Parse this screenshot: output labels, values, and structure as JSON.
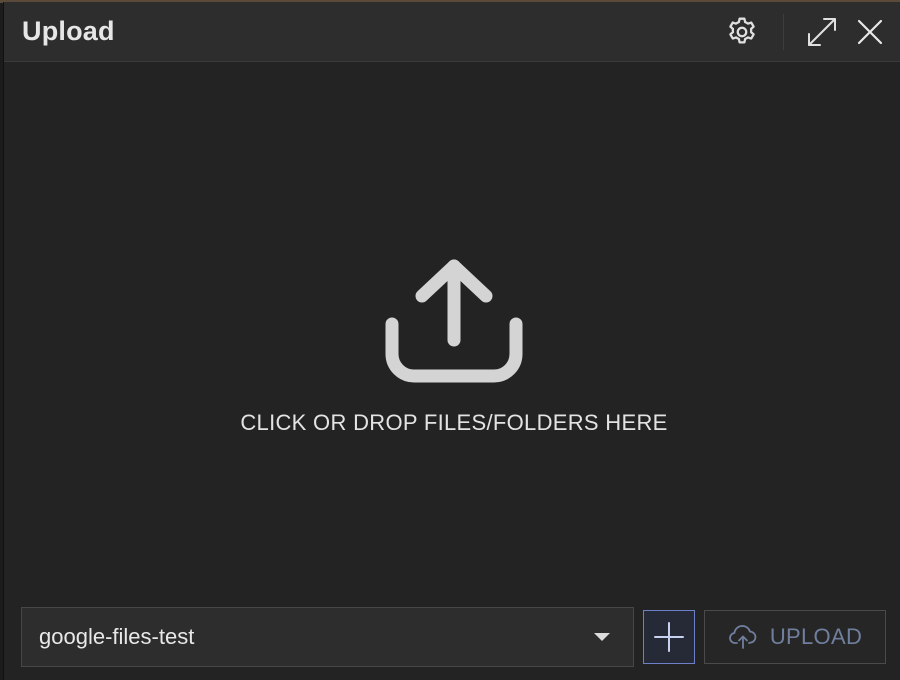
{
  "window": {
    "title": "Upload"
  },
  "toolbar": {
    "settings_icon": "gear-icon",
    "expand_icon": "expand-icon",
    "close_icon": "close-icon"
  },
  "dropzone": {
    "icon": "upload-tray-icon",
    "text": "CLICK OR DROP FILES/FOLDERS HERE"
  },
  "footer": {
    "bucket_selected": "google-files-test",
    "add_icon": "plus-icon",
    "upload_icon": "cloud-upload-icon",
    "upload_label": "UPLOAD"
  },
  "colors": {
    "background": "#232323",
    "titlebar": "#2d2d2d",
    "accent_border": "#6d7fc6",
    "disabled_text": "#707f9e"
  }
}
